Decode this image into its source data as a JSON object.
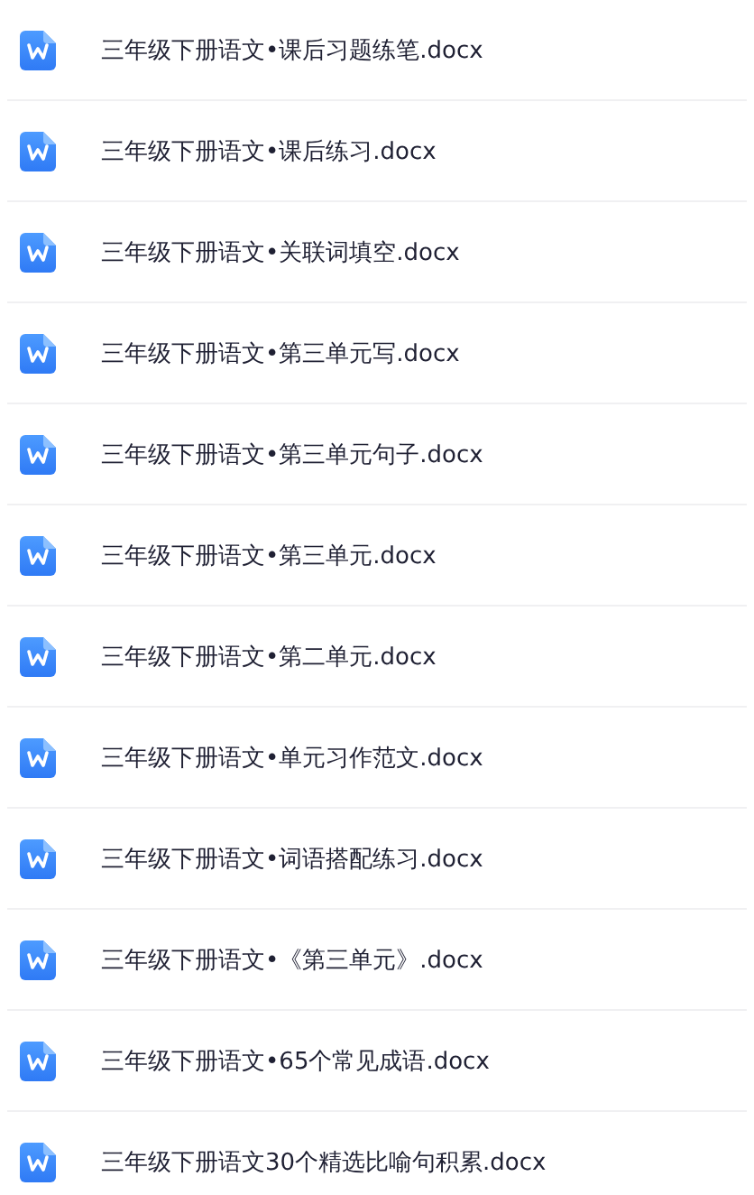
{
  "files": [
    {
      "name": "三年级下册语文•课后习题练笔.docx"
    },
    {
      "name": "三年级下册语文•课后练习.docx"
    },
    {
      "name": "三年级下册语文•关联词填空.docx"
    },
    {
      "name": "三年级下册语文•第三单元写.docx"
    },
    {
      "name": "三年级下册语文•第三单元句子.docx"
    },
    {
      "name": "三年级下册语文•第三单元.docx"
    },
    {
      "name": "三年级下册语文•第二单元.docx"
    },
    {
      "name": "三年级下册语文•单元习作范文.docx"
    },
    {
      "name": "三年级下册语文•词语搭配练习.docx"
    },
    {
      "name": "三年级下册语文•《第三单元》.docx"
    },
    {
      "name": "三年级下册语文•65个常见成语.docx"
    },
    {
      "name": "三年级下册语文30个精选比喻句积累.docx"
    }
  ]
}
